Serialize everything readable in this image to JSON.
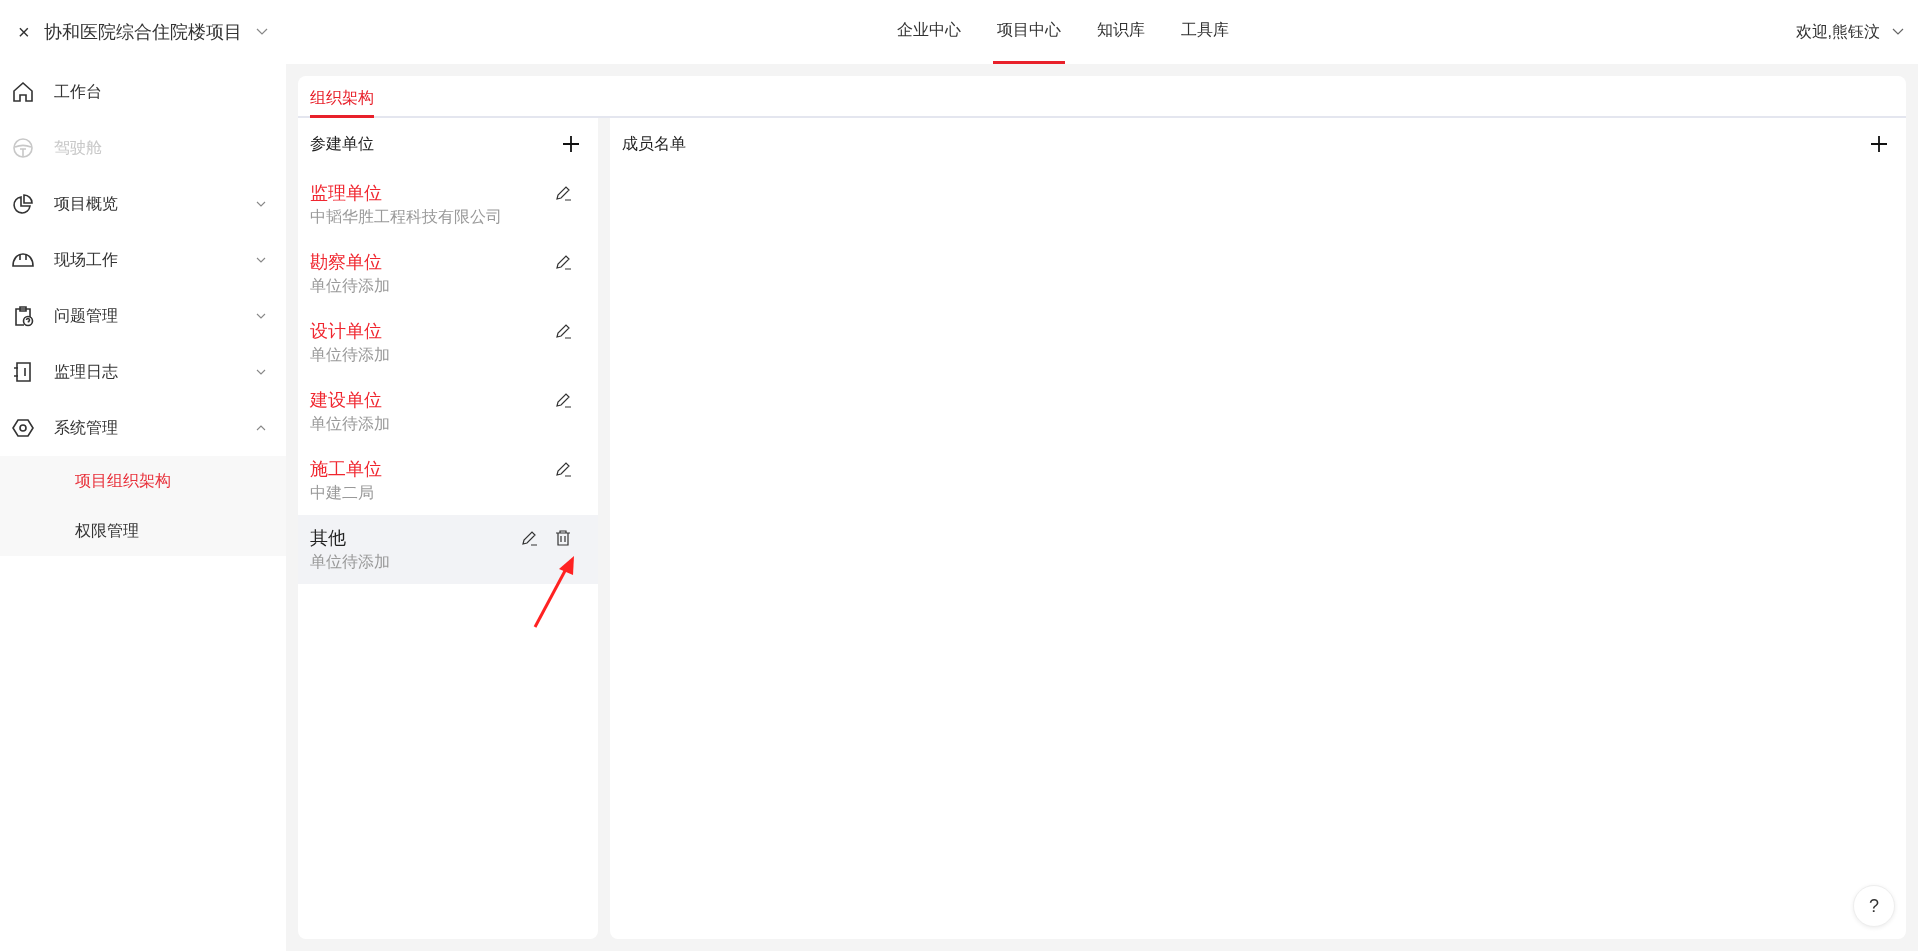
{
  "header": {
    "close_icon": "×",
    "project": "协和医院综合住院楼项目",
    "nav": [
      {
        "label": "企业中心",
        "selected": false
      },
      {
        "label": "项目中心",
        "selected": true
      },
      {
        "label": "知识库",
        "selected": false
      },
      {
        "label": "工具库",
        "selected": false
      }
    ],
    "user": "欢迎,熊钰汶"
  },
  "sidebar": {
    "items": [
      {
        "label": "工作台",
        "kind": "link",
        "disabled": false
      },
      {
        "label": "驾驶舱",
        "kind": "link",
        "disabled": true
      },
      {
        "label": "项目概览",
        "kind": "group",
        "disabled": false,
        "expanded": false
      },
      {
        "label": "现场工作",
        "kind": "group",
        "disabled": false,
        "expanded": false
      },
      {
        "label": "问题管理",
        "kind": "group",
        "disabled": false,
        "expanded": false
      },
      {
        "label": "监理日志",
        "kind": "group",
        "disabled": false,
        "expanded": false
      },
      {
        "label": "系统管理",
        "kind": "group",
        "disabled": false,
        "expanded": true,
        "children": [
          {
            "label": "项目组织架构",
            "selected": true
          },
          {
            "label": "权限管理",
            "selected": false
          }
        ]
      }
    ]
  },
  "tabs": [
    {
      "label": "组织架构",
      "selected": true
    }
  ],
  "units_panel": {
    "title": "参建单位",
    "units": [
      {
        "name": "监理单位",
        "detail": "中韬华胜工程科技有限公司",
        "kind": "fixed",
        "selected": false
      },
      {
        "name": "勘察单位",
        "detail": "单位待添加",
        "kind": "fixed",
        "selected": false
      },
      {
        "name": "设计单位",
        "detail": "单位待添加",
        "kind": "fixed",
        "selected": false
      },
      {
        "name": "建设单位",
        "detail": "单位待添加",
        "kind": "fixed",
        "selected": false
      },
      {
        "name": "施工单位",
        "detail": "中建二局",
        "kind": "fixed",
        "selected": false
      },
      {
        "name": "其他",
        "detail": "单位待添加",
        "kind": "custom",
        "selected": true
      }
    ]
  },
  "members_panel": {
    "title": "成员名单"
  },
  "help_button": "?"
}
